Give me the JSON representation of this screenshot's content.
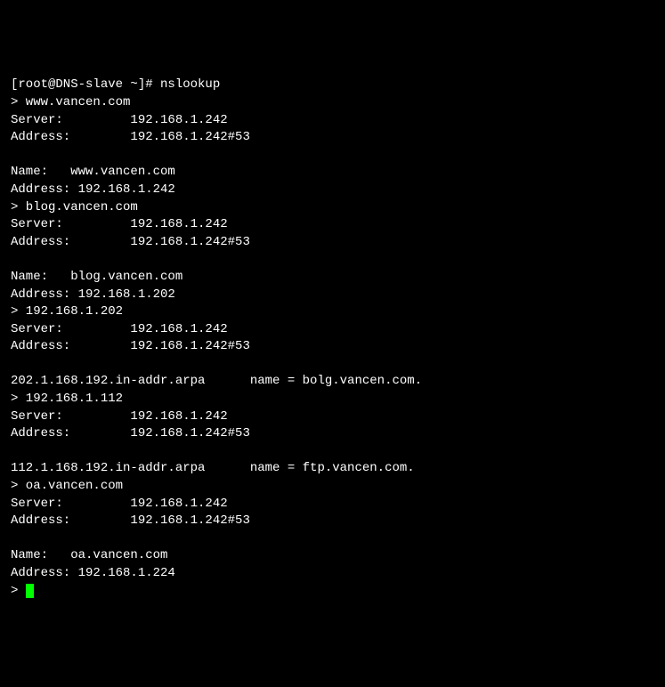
{
  "lines": {
    "l0": "[root@DNS-slave ~]# nslookup",
    "l1": "> www.vancen.com",
    "l2": "Server:         192.168.1.242",
    "l3": "Address:        192.168.1.242#53",
    "l4": "",
    "l5": "Name:   www.vancen.com",
    "l6": "Address: 192.168.1.242",
    "l7": "> blog.vancen.com",
    "l8": "Server:         192.168.1.242",
    "l9": "Address:        192.168.1.242#53",
    "l10": "",
    "l11": "Name:   blog.vancen.com",
    "l12": "Address: 192.168.1.202",
    "l13": "> 192.168.1.202",
    "l14": "Server:         192.168.1.242",
    "l15": "Address:        192.168.1.242#53",
    "l16": "",
    "l17": "202.1.168.192.in-addr.arpa      name = bolg.vancen.com.",
    "l18": "> 192.168.1.112",
    "l19": "Server:         192.168.1.242",
    "l20": "Address:        192.168.1.242#53",
    "l21": "",
    "l22": "112.1.168.192.in-addr.arpa      name = ftp.vancen.com.",
    "l23": "> oa.vancen.com",
    "l24": "Server:         192.168.1.242",
    "l25": "Address:        192.168.1.242#53",
    "l26": "",
    "l27": "Name:   oa.vancen.com",
    "l28": "Address: 192.168.1.224",
    "l29": "> "
  }
}
